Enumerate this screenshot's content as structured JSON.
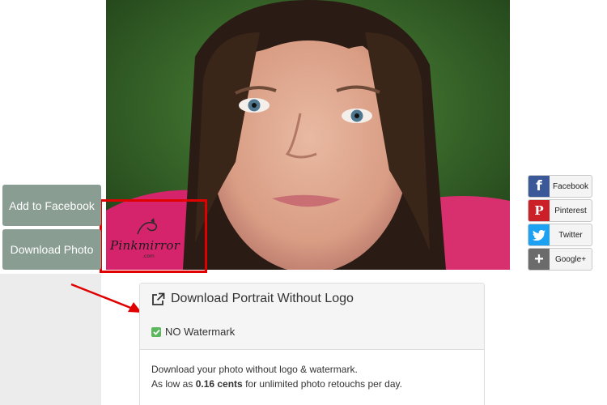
{
  "buttons": {
    "add_to_facebook": "Add to Facebook",
    "download_photo": "Download Photo"
  },
  "watermark_logo": {
    "brand": "Pinkmirror",
    "domain": ".com"
  },
  "share": [
    {
      "label": "Facebook",
      "icon": "facebook-icon",
      "color": "#3b5998"
    },
    {
      "label": "Pinterest",
      "icon": "pinterest-icon",
      "color": "#cb2027"
    },
    {
      "label": "Twitter",
      "icon": "twitter-icon",
      "color": "#1da1f2"
    },
    {
      "label": "Google+",
      "icon": "google-plus-icon",
      "color": "#6b6b6b"
    }
  ],
  "panel": {
    "title": "Download Portrait Without Logo",
    "watermark_option": "NO Watermark",
    "line1": "Download your photo without logo & watermark.",
    "line2_pre": "As low as ",
    "line2_price": "0.16 cents",
    "line2_post": " for unlimited photo retouchs per day."
  },
  "colors": {
    "highlight_red": "#e00000",
    "button_gray_green": "#8a9d92",
    "check_green": "#5cb85c"
  }
}
